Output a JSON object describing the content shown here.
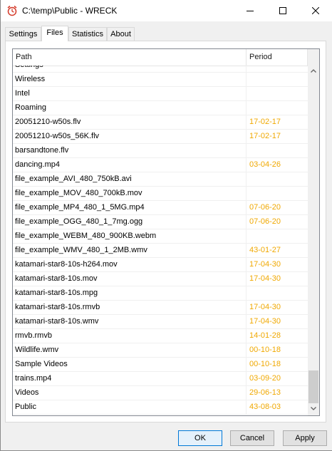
{
  "window": {
    "title": "C:\\temp\\Public - WRECK",
    "icon": "clock-alarm-icon"
  },
  "tabs": [
    {
      "label": "Settings",
      "active": false
    },
    {
      "label": "Files",
      "active": true
    },
    {
      "label": "Statistics",
      "active": false
    },
    {
      "label": "About",
      "active": false
    }
  ],
  "list": {
    "columns": {
      "path": "Path",
      "period": "Period"
    },
    "partial_top_row": "Settings",
    "rows": [
      {
        "path": "Wireless",
        "period": ""
      },
      {
        "path": "Intel",
        "period": ""
      },
      {
        "path": "Roaming",
        "period": ""
      },
      {
        "path": "20051210-w50s.flv",
        "period": "17-02-17"
      },
      {
        "path": "20051210-w50s_56K.flv",
        "period": "17-02-17"
      },
      {
        "path": "barsandtone.flv",
        "period": ""
      },
      {
        "path": "dancing.mp4",
        "period": "03-04-26"
      },
      {
        "path": "file_example_AVI_480_750kB.avi",
        "period": ""
      },
      {
        "path": "file_example_MOV_480_700kB.mov",
        "period": ""
      },
      {
        "path": "file_example_MP4_480_1_5MG.mp4",
        "period": "07-06-20"
      },
      {
        "path": "file_example_OGG_480_1_7mg.ogg",
        "period": "07-06-20"
      },
      {
        "path": "file_example_WEBM_480_900KB.webm",
        "period": ""
      },
      {
        "path": "file_example_WMV_480_1_2MB.wmv",
        "period": "43-01-27"
      },
      {
        "path": "katamari-star8-10s-h264.mov",
        "period": "17-04-30"
      },
      {
        "path": "katamari-star8-10s.mov",
        "period": "17-04-30"
      },
      {
        "path": "katamari-star8-10s.mpg",
        "period": ""
      },
      {
        "path": "katamari-star8-10s.rmvb",
        "period": "17-04-30"
      },
      {
        "path": "katamari-star8-10s.wmv",
        "period": "17-04-30"
      },
      {
        "path": "rmvb.rmvb",
        "period": "14-01-28"
      },
      {
        "path": "Wildlife.wmv",
        "period": "00-10-18"
      },
      {
        "path": "Sample Videos",
        "period": "00-10-18"
      },
      {
        "path": "trains.mp4",
        "period": "03-09-20"
      },
      {
        "path": "Videos",
        "period": "29-06-13"
      },
      {
        "path": "Public",
        "period": "43-08-03"
      }
    ],
    "scroll_position": 1.0,
    "visible_fraction": 0.1
  },
  "buttons": {
    "ok": "OK",
    "cancel": "Cancel",
    "apply": "Apply"
  },
  "colors": {
    "period_text": "#f0a800",
    "default_button_border": "#0078d7"
  }
}
